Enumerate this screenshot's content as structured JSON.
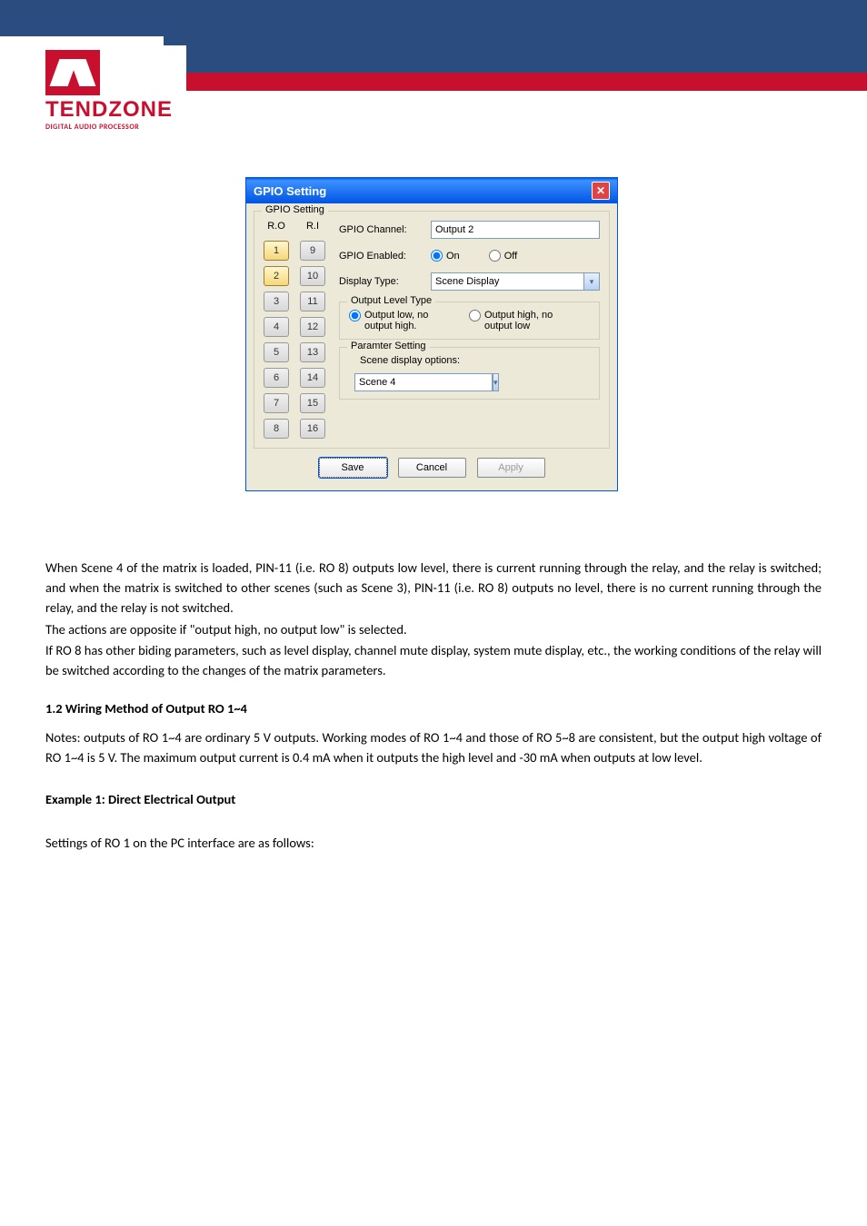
{
  "logo": {
    "brand": "TENDZONE",
    "tagline": "DIGITAL AUDIO PROCESSOR"
  },
  "window": {
    "title": "GPIO Setting",
    "fieldset_legend": "GPIO Setting",
    "col_ro": "R.O",
    "col_ri": "R.I",
    "pins_ro": [
      "1",
      "2",
      "3",
      "4",
      "5",
      "6",
      "7",
      "8"
    ],
    "pins_ri": [
      "9",
      "10",
      "11",
      "12",
      "13",
      "14",
      "15",
      "16"
    ],
    "label_channel": "GPIO Channel:",
    "val_channel": "Output 2",
    "label_enabled": "GPIO Enabled:",
    "opt_on": "On",
    "opt_off": "Off",
    "label_display": "Display Type:",
    "val_display": "Scene Display",
    "legend_olt": "Output Level Type",
    "olt_a": "Output low, no output high.",
    "olt_b": "Output high, no output low",
    "legend_param": "Paramter Setting",
    "param_label": "Scene display options:",
    "val_scene": "Scene 4",
    "btn_save": "Save",
    "btn_cancel": "Cancel",
    "btn_apply": "Apply"
  },
  "doc": {
    "p1": "When Scene 4 of the matrix is loaded, PIN-11 (i.e. RO 8) outputs low level, there is current running through the relay, and the relay is switched; and when the matrix is switched to other scenes (such as Scene 3), PIN-11 (i.e. RO 8) outputs no level, there is no current running through the relay, and the relay is not switched.",
    "p2": "The actions are opposite if \"output high, no output low\" is selected.",
    "p3": "If RO 8 has other biding parameters, such as level display, channel mute display, system mute display, etc., the working conditions of the relay will be switched according to the changes of the matrix parameters.",
    "h1": "1.2 Wiring Method of Output RO 1~4",
    "p4": "Notes: outputs of RO 1~4 are ordinary 5 V outputs. Working modes of RO 1~4 and those of RO 5~8 are consistent, but the output high voltage of RO 1~4 is 5 V. The maximum output current is 0.4 mA when it outputs the high level and -30 mA when outputs at low level.",
    "ex1": "Example 1: Direct Electrical Output",
    "p5": "Settings of RO 1 on the PC interface are as follows:"
  }
}
